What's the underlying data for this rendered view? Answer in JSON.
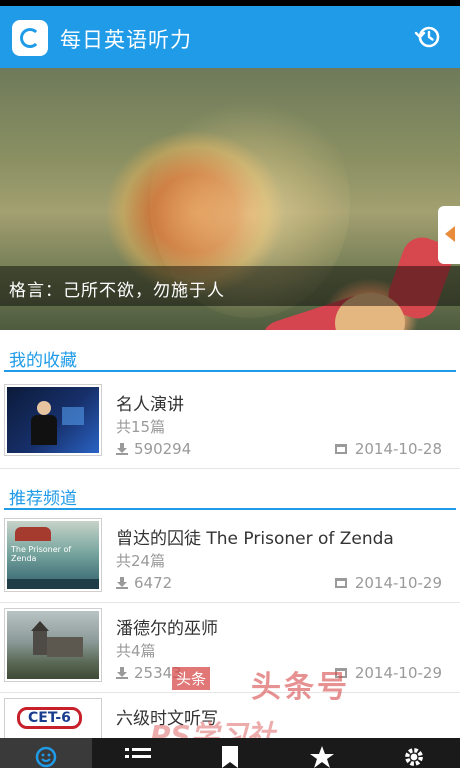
{
  "app": {
    "title": "每日英语听力",
    "icon": "app-logo-icon",
    "history_icon": "history-icon"
  },
  "banner": {
    "caption": "格言：己所不欲，勿施于人",
    "dots_total": 6,
    "active_dot": 0
  },
  "favorites": {
    "header": "我的收藏",
    "items": [
      {
        "title": "名人演讲",
        "count": "共15篇",
        "downloads": "590294",
        "date": "2014-10-28"
      }
    ]
  },
  "recommended": {
    "header": "推荐频道",
    "items": [
      {
        "title": "曾达的囚徒 The Prisoner of Zenda",
        "count": "共24篇",
        "downloads": "6472",
        "date": "2014-10-29",
        "thumb_title": "The Prisoner of Zenda"
      },
      {
        "title": "潘德尔的巫师",
        "count": "共4篇",
        "downloads": "25343",
        "date": "2014-10-29"
      },
      {
        "title": "六级时文听写",
        "count": "",
        "downloads": "",
        "date": "",
        "thumb_title": "CET-6"
      }
    ]
  },
  "watermark": {
    "tag": "头条",
    "text": "头条号",
    "text2": "PS学习社"
  },
  "tabbar": {
    "tabs": [
      {
        "icon": "smile-icon",
        "active": true
      },
      {
        "icon": "list-icon",
        "active": false
      },
      {
        "icon": "bookmark-icon",
        "active": false
      },
      {
        "icon": "star-icon",
        "active": false
      },
      {
        "icon": "gear-icon",
        "active": false
      }
    ]
  },
  "colors": {
    "accent": "#1f9be8",
    "text_secondary": "#9a9a9a",
    "tabbar": "#1a1a1a"
  }
}
